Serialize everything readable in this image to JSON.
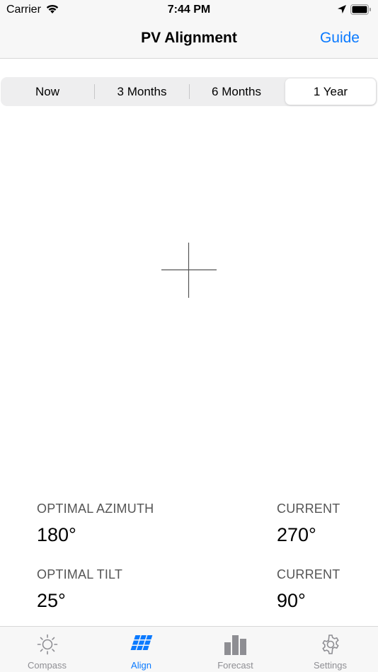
{
  "status_bar": {
    "carrier": "Carrier",
    "time": "7:44 PM"
  },
  "nav": {
    "title": "PV Alignment",
    "guide_label": "Guide"
  },
  "segments": [
    {
      "label": "Now",
      "selected": false
    },
    {
      "label": "3 Months",
      "selected": false
    },
    {
      "label": "6 Months",
      "selected": false
    },
    {
      "label": "1 Year",
      "selected": true
    }
  ],
  "readouts": {
    "optimal_azimuth_label": "OPTIMAL AZIMUTH",
    "optimal_azimuth_value": "180°",
    "current_azimuth_label": "CURRENT",
    "current_azimuth_value": "270°",
    "optimal_tilt_label": "OPTIMAL TILT",
    "optimal_tilt_value": "25°",
    "current_tilt_label": "CURRENT",
    "current_tilt_value": "90°"
  },
  "tabs": [
    {
      "label": "Compass",
      "icon": "sun-icon",
      "active": false
    },
    {
      "label": "Align",
      "icon": "solar-panel-icon",
      "active": true
    },
    {
      "label": "Forecast",
      "icon": "bar-chart-icon",
      "active": false
    },
    {
      "label": "Settings",
      "icon": "gear-icon",
      "active": false
    }
  ],
  "colors": {
    "accent": "#0a7aff",
    "inactive_tab": "#8e8e93",
    "bar_background": "#f7f7f7"
  }
}
